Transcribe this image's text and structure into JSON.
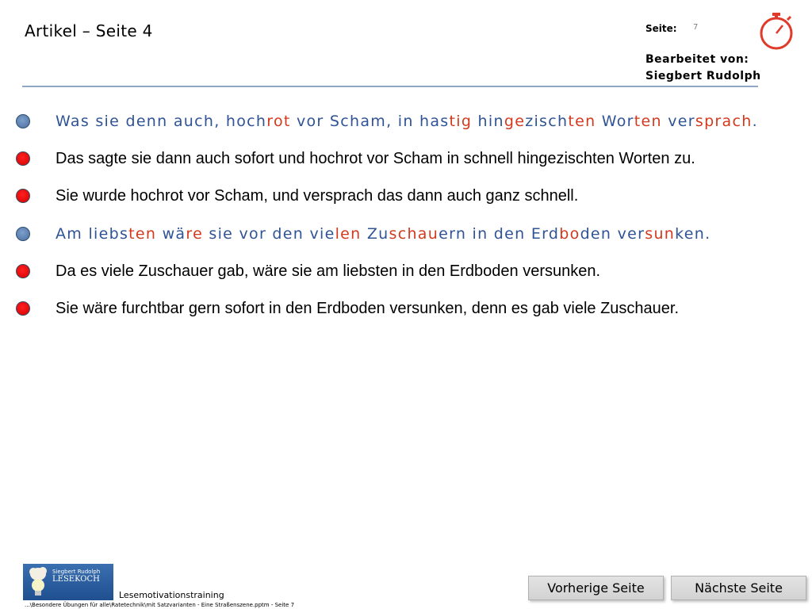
{
  "header": {
    "title": "Artikel – Seite 4",
    "page_label": "Seite:",
    "page_number": "7",
    "editor_label": "Bearbeitet von:",
    "editor_name": "Siegbert Rudolph",
    "stopwatch_icon": "stopwatch-icon"
  },
  "sentences": [
    {
      "bullet_color": "blue",
      "syllable_colored": true,
      "segments": [
        {
          "text": "Was sie denn auch, hoch",
          "color": "blue"
        },
        {
          "text": "rot",
          "color": "red"
        },
        {
          "text": " vor Scham, in has",
          "color": "blue"
        },
        {
          "text": "tig",
          "color": "red"
        },
        {
          "text": " hin",
          "color": "blue"
        },
        {
          "text": "ge",
          "color": "red"
        },
        {
          "text": "zisch",
          "color": "blue"
        },
        {
          "text": "ten",
          "color": "red"
        },
        {
          "text": " Wor",
          "color": "blue"
        },
        {
          "text": "ten",
          "color": "red"
        },
        {
          "text": " ver",
          "color": "blue"
        },
        {
          "text": "sprach",
          "color": "red"
        },
        {
          "text": ".",
          "color": "blue"
        }
      ]
    },
    {
      "bullet_color": "red",
      "syllable_colored": false,
      "segments": [
        {
          "text": "Das sagte sie dann auch sofort und hochrot vor Scham in schnell hingezischten Worten zu.",
          "color": "black"
        }
      ]
    },
    {
      "bullet_color": "red",
      "syllable_colored": false,
      "segments": [
        {
          "text": "Sie wurde hochrot vor Scham, und versprach das dann auch ganz schnell.",
          "color": "black"
        }
      ]
    },
    {
      "bullet_color": "blue",
      "syllable_colored": true,
      "segments": [
        {
          "text": "Am liebs",
          "color": "blue"
        },
        {
          "text": "ten",
          "color": "red"
        },
        {
          "text": " wä",
          "color": "blue"
        },
        {
          "text": "re",
          "color": "red"
        },
        {
          "text": " sie vor den vie",
          "color": "blue"
        },
        {
          "text": "len",
          "color": "red"
        },
        {
          "text": " Zu",
          "color": "blue"
        },
        {
          "text": "schau",
          "color": "red"
        },
        {
          "text": "ern in den Erd",
          "color": "blue"
        },
        {
          "text": "bo",
          "color": "red"
        },
        {
          "text": "den ver",
          "color": "blue"
        },
        {
          "text": "sun",
          "color": "red"
        },
        {
          "text": "ken.",
          "color": "blue"
        }
      ]
    },
    {
      "bullet_color": "red",
      "syllable_colored": false,
      "segments": [
        {
          "text": "Da es viele Zuschauer gab, wäre sie am liebsten in den Erdboden versunken.",
          "color": "black"
        }
      ]
    },
    {
      "bullet_color": "red",
      "syllable_colored": false,
      "segments": [
        {
          "text": "Sie wäre furchtbar gern sofort in den Erdboden versunken, denn es gab viele Zuschauer.",
          "color": "black"
        }
      ]
    }
  ],
  "footer": {
    "logo_small_text": "Siegbert Rudolph",
    "logo_text": "LESEKOCH",
    "brand": "Lesemotivationstraining",
    "path": "...\\Besondere Übungen für alle\\Ratetechnik\\mit Satzvarianten - Eine Straßenszene.pptm - Seite 7"
  },
  "navigation": {
    "previous_label": "Vorherige Seite",
    "next_label": "Nächste Seite"
  },
  "colors": {
    "syllable_blue": "#2f5395",
    "syllable_red": "#d23a1e",
    "bullet_blue": "#4c6fa0",
    "bullet_red": "#e00000",
    "header_rule": "#8fa8c4",
    "stopwatch": "#e03a2a"
  }
}
